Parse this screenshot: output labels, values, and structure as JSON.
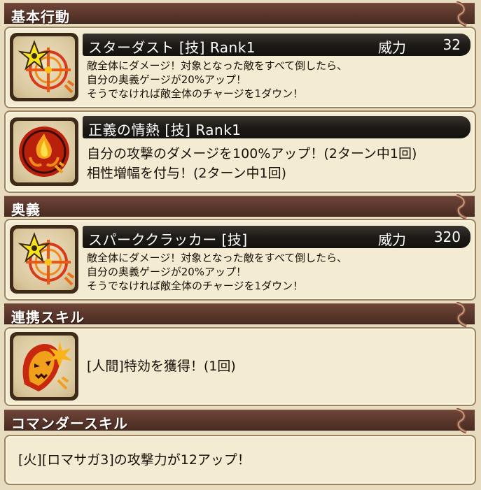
{
  "sections": {
    "basic": {
      "label": "基本行動"
    },
    "ougi": {
      "label": "奥義"
    },
    "renkei": {
      "label": "連携スキル"
    },
    "commander": {
      "label": "コマンダースキル"
    }
  },
  "skills": [
    {
      "name": "スターダスト [技]  Rank1",
      "icon": "shuriken-fire-icon",
      "power_label": "威力",
      "power_value": "32",
      "lines": [
        "敵全体にダメージ！対象となった敵をすべて倒したら、",
        "自分の奥義ゲージが20%アップ！",
        "そうでなければ敵全体のチャージを1ダウン！"
      ]
    },
    {
      "name": "正義の情熱 [技]  Rank1",
      "icon": "flame-emblem-icon",
      "lines": [
        "自分の攻撃のダメージを100%アップ！(2ターン中1回)",
        "相性増幅を付与！(2ターン中1回)"
      ]
    },
    {
      "name": "スパーククラッカー [技]",
      "icon": "shuriken-fire-icon",
      "power_label": "威力",
      "power_value": "320",
      "lines": [
        "敵全体にダメージ！対象となった敵をすべて倒したら、",
        "自分の奥義ゲージが20%アップ！",
        "そうでなければ敵全体のチャージを1ダウン！"
      ]
    }
  ],
  "renkei_skill": {
    "icon": "demon-mask-fire-icon",
    "text": "[人間]特効を獲得！(1回)"
  },
  "commander_skill": {
    "text": "[火][ロマサガ3]の攻撃力が12アップ！"
  },
  "colors": {
    "section_bar": "#5a362b",
    "card_bg": "#f4ecd2",
    "title_bar": "#1e1a16",
    "page_bg": "#e8dcc0"
  }
}
